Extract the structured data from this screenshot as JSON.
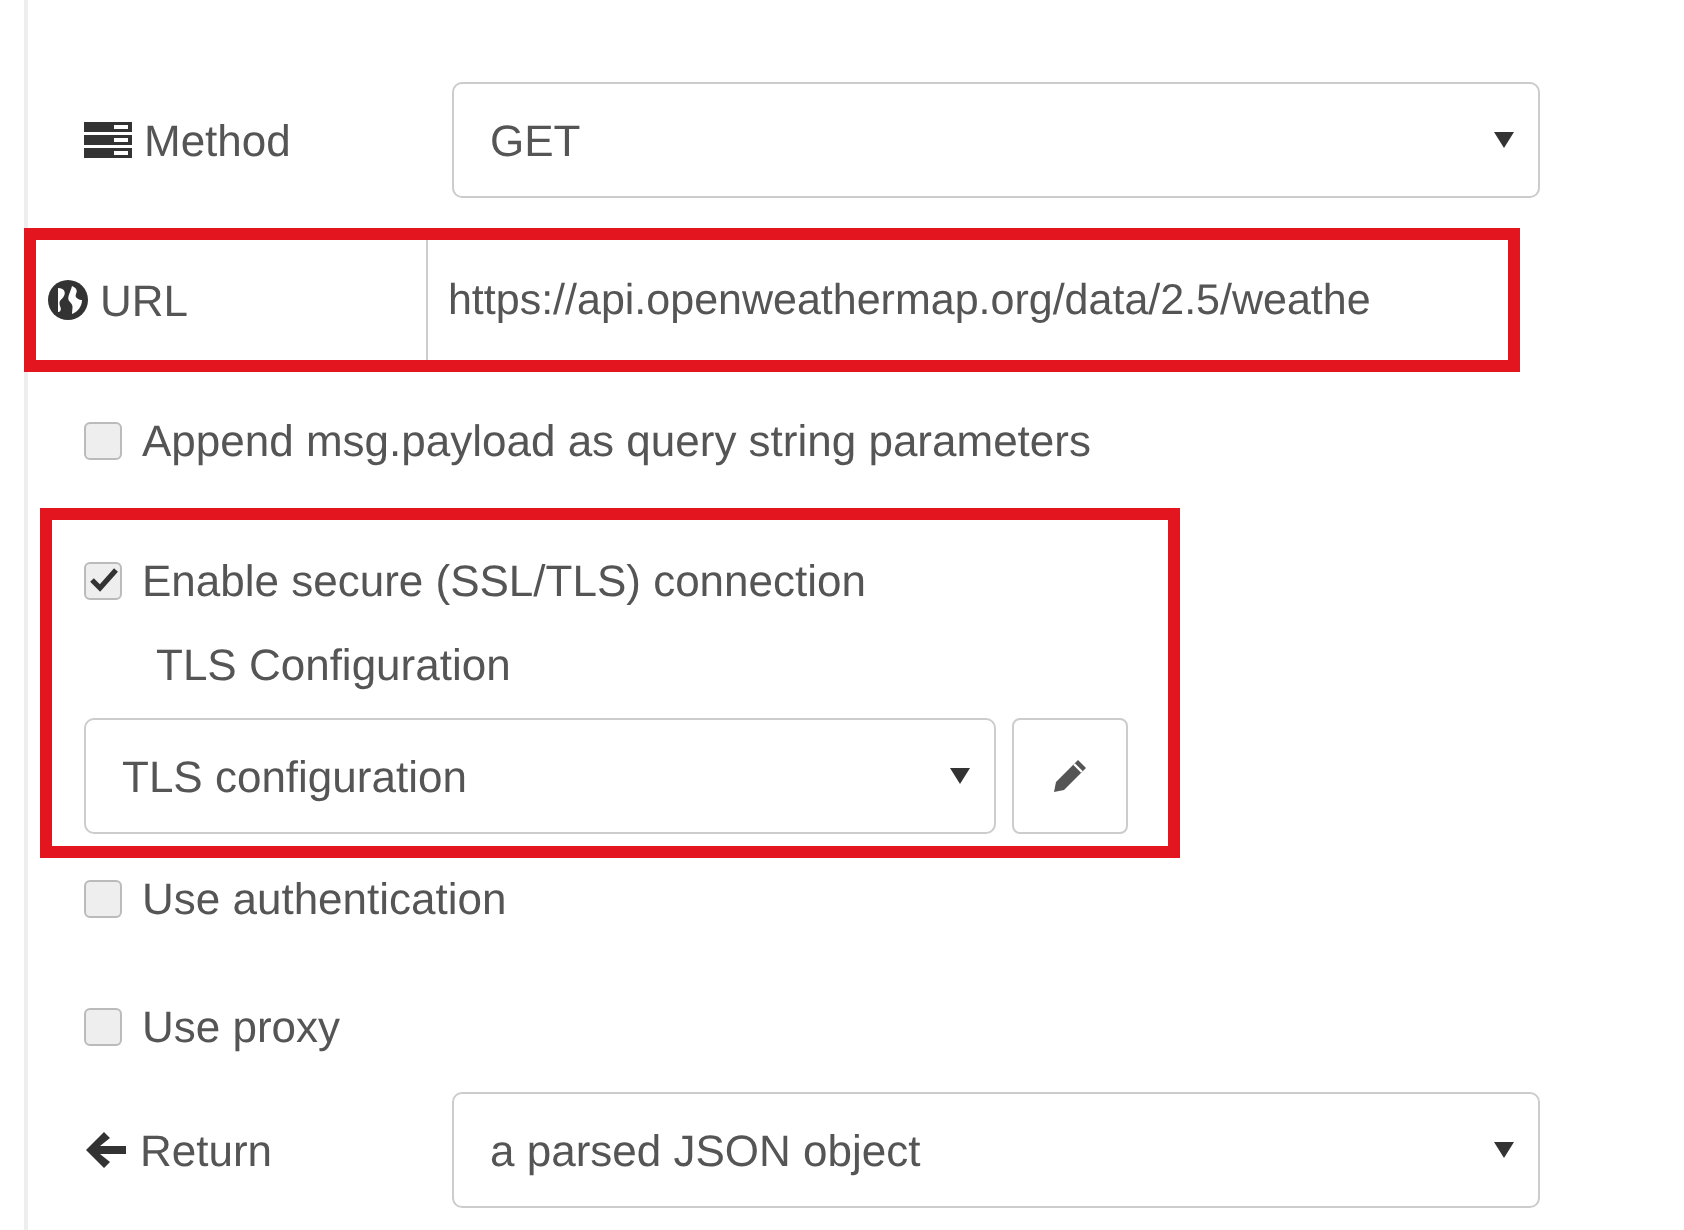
{
  "method": {
    "label": "Method",
    "value": "GET"
  },
  "url": {
    "label": "URL",
    "value": "https://api.openweathermap.org/data/2.5/weathe",
    "highlighted": true
  },
  "append_payload": {
    "label": "Append msg.payload as query string parameters",
    "checked": false
  },
  "tls": {
    "highlighted": true,
    "enable": {
      "label": "Enable secure (SSL/TLS) connection",
      "checked": true
    },
    "config_label": "TLS Configuration",
    "config_value": "TLS configuration"
  },
  "use_authentication": {
    "label": "Use authentication",
    "checked": false
  },
  "use_proxy": {
    "label": "Use proxy",
    "checked": false
  },
  "return": {
    "label": "Return",
    "value": "a parsed JSON object"
  }
}
